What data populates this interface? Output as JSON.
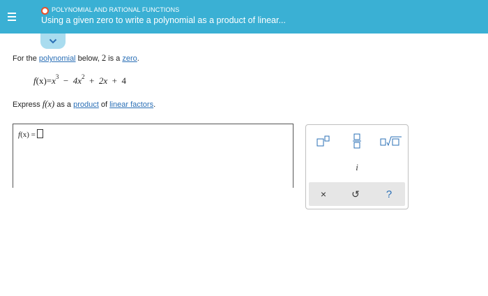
{
  "header": {
    "topic": "POLYNOMIAL AND RATIONAL FUNCTIONS",
    "title": "Using a given zero to write a polynomial as a product of linear...",
    "menu_icon": "hamburger-icon",
    "status_color": "#e8502a",
    "bar_color": "#3ab0d4"
  },
  "expand_icon": "chevron-down-icon",
  "prompt": {
    "text_before": "For the",
    "link_polynomial": "polynomial",
    "text_mid": "below,",
    "zero_value": "2",
    "text_is_a": "is a",
    "link_zero": "zero",
    "text_end": "."
  },
  "formula": {
    "lhs_f": "f",
    "lhs_paren": "(x)",
    "eq": "=",
    "t1_var": "x",
    "t1_exp": "3",
    "op1": "−",
    "t2": "4x",
    "t2_exp": "2",
    "op2": "+",
    "t3": "2x",
    "op3": "+",
    "t4": "4"
  },
  "instruction": {
    "express": "Express",
    "fx": "f(x)",
    "as_a": "as a",
    "link_product": "product",
    "of": "of",
    "link_linear": "linear factors",
    "period": "."
  },
  "answer": {
    "label_f": "f",
    "label_rest": "(x) ="
  },
  "keypad": {
    "i_key": "i",
    "clear_key": "×",
    "undo_key": "↺",
    "help_key": "?"
  }
}
